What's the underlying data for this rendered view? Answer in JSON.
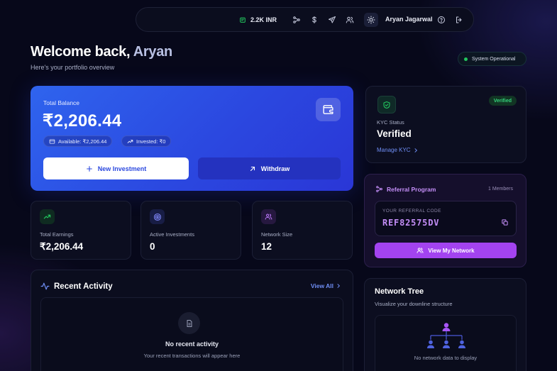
{
  "nav": {
    "balance": "2.2K INR",
    "user_name": "Aryan Jagarwal"
  },
  "header": {
    "welcome_prefix": "Welcome back, ",
    "welcome_name": "Aryan",
    "subtitle": "Here's your portfolio overview",
    "status": "System Operational"
  },
  "balance_card": {
    "label": "Total Balance",
    "amount": "₹2,206.44",
    "available": "Available: ₹2,206.44",
    "invested": "Invested: ₹0",
    "new_investment": "New Investment",
    "withdraw": "Withdraw"
  },
  "stats": [
    {
      "label": "Total Earnings",
      "value": "₹2,206.44",
      "color": "#22c55e"
    },
    {
      "label": "Active Investments",
      "value": "0",
      "color": "#6366f1"
    },
    {
      "label": "Network Size",
      "value": "12",
      "color": "#a855f7"
    }
  ],
  "activity": {
    "title": "Recent Activity",
    "view_all": "View All",
    "empty_title": "No recent activity",
    "empty_sub": "Your recent transactions will appear here"
  },
  "kyc": {
    "badge": "Verified",
    "label": "KYC Status",
    "value": "Verified",
    "manage": "Manage KYC"
  },
  "referral": {
    "title": "Referral Program",
    "members": "1 Members",
    "code_label": "YOUR REFERRAL CODE",
    "code": "REF82575DV",
    "view_network": "View My Network"
  },
  "tree": {
    "title": "Network Tree",
    "subtitle": "Visualize your downline structure",
    "empty": "No network data to display"
  },
  "colors": {
    "accent_blue": "#2f5ae8",
    "accent_purple": "#a343f0",
    "success": "#22c55e",
    "link": "#6f8ef5"
  }
}
